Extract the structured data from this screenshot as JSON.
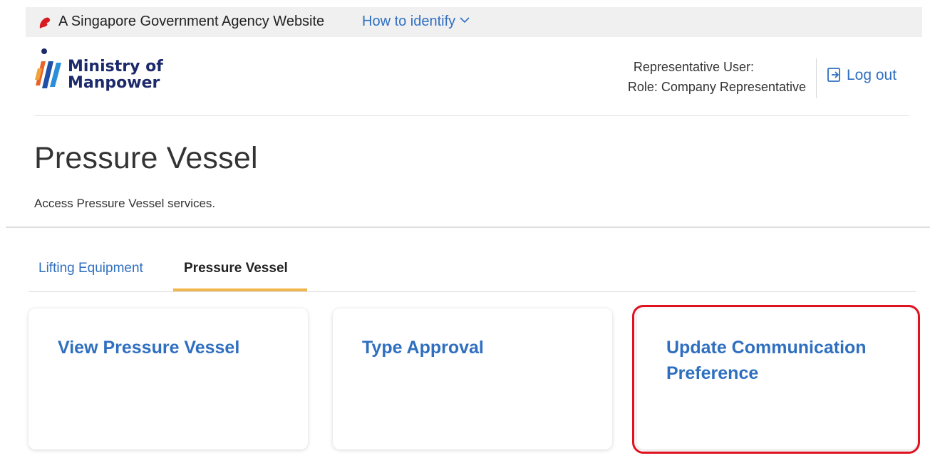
{
  "masthead": {
    "text": "A Singapore Government Agency Website",
    "identify_link": "How to identify",
    "lion_color": "#d71920"
  },
  "header": {
    "logo_text_line1": "Ministry of",
    "logo_text_line2": "Manpower",
    "user_label": "Representative User:",
    "role_label": "Role: Company Representative",
    "logout_label": "Log out"
  },
  "page": {
    "title": "Pressure Vessel",
    "subtitle": "Access Pressure Vessel services."
  },
  "tabs": [
    {
      "label": "Lifting Equipment",
      "active": false
    },
    {
      "label": "Pressure Vessel",
      "active": true
    }
  ],
  "cards": [
    {
      "title": "View Pressure Vessel"
    },
    {
      "title": "Type Approval"
    },
    {
      "title": "Update Communication Preference",
      "highlighted": true
    }
  ],
  "colors": {
    "link_blue": "#2f6fc0",
    "tab_active_underline": "#f0b64b",
    "highlight_red": "#e0121f",
    "logo_navy": "#1c2a6b"
  }
}
